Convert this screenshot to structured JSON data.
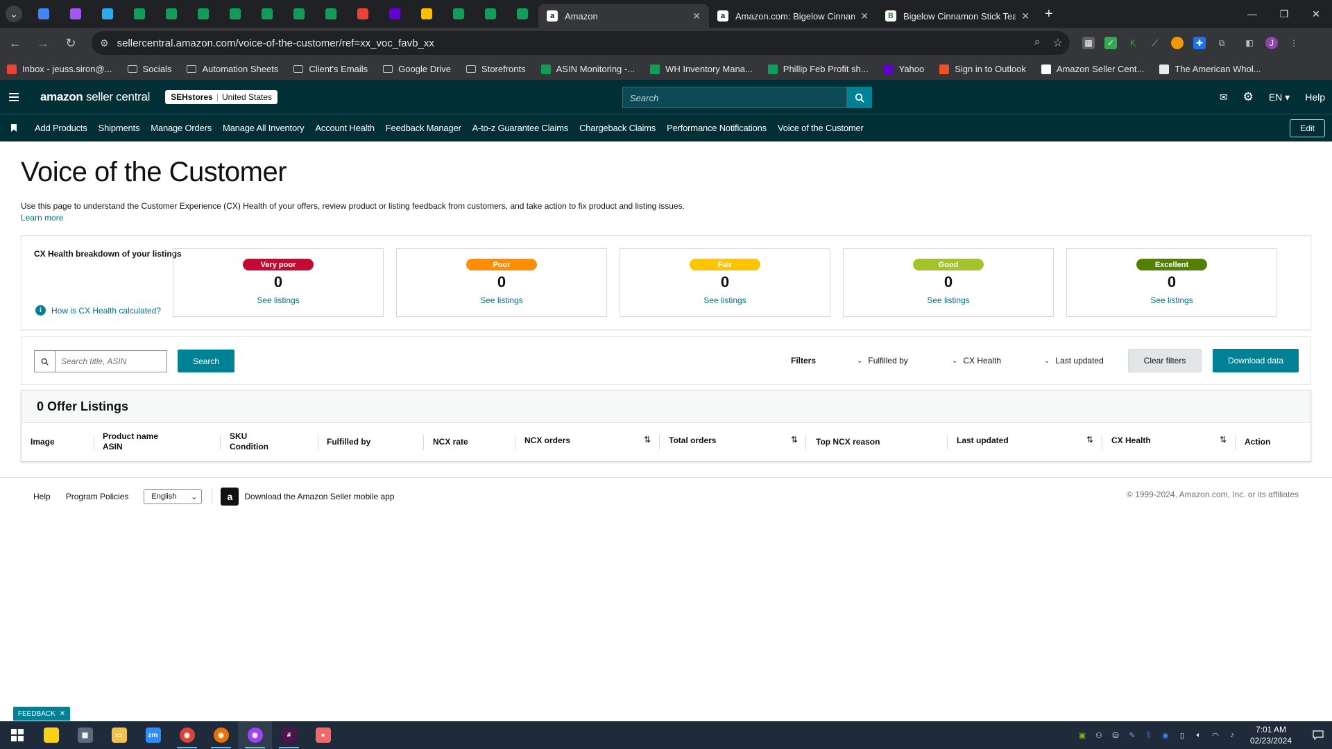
{
  "browser": {
    "pinned_tabs": [
      {
        "icon": "google-docs-icon",
        "color": "#4285f4"
      },
      {
        "icon": "messenger-icon",
        "color": "#a855f7"
      },
      {
        "icon": "telegram-icon",
        "color": "#2aabee"
      },
      {
        "icon": "google-sheets-icon",
        "color": "#0f9d58"
      },
      {
        "icon": "google-sheets-icon",
        "color": "#0f9d58"
      },
      {
        "icon": "google-sheets-icon",
        "color": "#0f9d58"
      },
      {
        "icon": "google-sheets-icon",
        "color": "#0f9d58"
      },
      {
        "icon": "google-sheets-icon",
        "color": "#0f9d58"
      },
      {
        "icon": "google-sheets-icon",
        "color": "#0f9d58"
      },
      {
        "icon": "google-sheets-icon",
        "color": "#0f9d58"
      },
      {
        "icon": "gmail-icon",
        "color": "#ea4335"
      },
      {
        "icon": "yahoo-mail-icon",
        "color": "#6001d2"
      },
      {
        "icon": "google-drive-icon",
        "color": "#fbbc04"
      },
      {
        "icon": "google-sheets-icon",
        "color": "#0f9d58"
      },
      {
        "icon": "google-sheets-icon",
        "color": "#0f9d58"
      },
      {
        "icon": "google-sheets-icon",
        "color": "#0f9d58"
      }
    ],
    "tabs": [
      {
        "title": "Amazon",
        "active": true
      },
      {
        "title": "Amazon.com: Bigelow Cinnamon",
        "active": false
      },
      {
        "title": "Bigelow Cinnamon Stick Tea Ba",
        "active": false
      }
    ],
    "url": "sellercentral.amazon.com/voice-of-the-customer/ref=xx_voc_favb_xx",
    "bookmarks": [
      {
        "label": "Inbox - jeuss.siron@...",
        "icon": "gmail-icon"
      },
      {
        "label": "Socials",
        "icon": "folder-icon"
      },
      {
        "label": "Automation Sheets",
        "icon": "folder-icon"
      },
      {
        "label": "Client's Emails",
        "icon": "folder-icon"
      },
      {
        "label": "Google Drive",
        "icon": "folder-icon"
      },
      {
        "label": "Storefronts",
        "icon": "folder-icon"
      },
      {
        "label": "ASIN Monitoring -...",
        "icon": "google-sheets-icon"
      },
      {
        "label": "WH Inventory Mana...",
        "icon": "google-sheets-icon"
      },
      {
        "label": "Phillip Feb Profit sh...",
        "icon": "google-sheets-icon"
      },
      {
        "label": "Yahoo",
        "icon": "yahoo-icon"
      },
      {
        "label": "Sign in to Outlook",
        "icon": "microsoft-icon"
      },
      {
        "label": "Amazon Seller Cent...",
        "icon": "amazon-icon"
      },
      {
        "label": "The American Whol...",
        "icon": "globe-icon"
      }
    ]
  },
  "header": {
    "logo_main": "amazon",
    "logo_sub": "seller central",
    "store_name": "SEHstores",
    "marketplace": "United States",
    "search_placeholder": "Search",
    "language": "EN",
    "help": "Help"
  },
  "nav": {
    "items": [
      "Add Products",
      "Shipments",
      "Manage Orders",
      "Manage All Inventory",
      "Account Health",
      "Feedback Manager",
      "A-to-z Guarantee Claims",
      "Chargeback Claims",
      "Performance Notifications",
      "Voice of the Customer"
    ],
    "edit_label": "Edit"
  },
  "page": {
    "title": "Voice of the Customer",
    "description": "Use this page to understand the Customer Experience (CX) Health of your offers, review product or listing feedback from customers, and take action to fix product and listing issues.",
    "learn_more": "Learn more"
  },
  "health": {
    "label": "CX Health breakdown of your listings",
    "how_link": "How is CX Health calculated?",
    "cards": [
      {
        "badge": "Very poor",
        "color": "#c40a32",
        "count": "0",
        "link": "See listings"
      },
      {
        "badge": "Poor",
        "color": "#ff8f00",
        "count": "0",
        "link": "See listings"
      },
      {
        "badge": "Fair",
        "color": "#ffc400",
        "count": "0",
        "link": "See listings"
      },
      {
        "badge": "Good",
        "color": "#a2c429",
        "count": "0",
        "link": "See listings"
      },
      {
        "badge": "Excellent",
        "color": "#538000",
        "count": "0",
        "link": "See listings"
      }
    ]
  },
  "filters": {
    "search_placeholder": "Search title, ASIN",
    "search_button": "Search",
    "filters_label": "Filters",
    "fulfilled_by": "Fulfilled by",
    "cx_health": "CX Health",
    "last_updated": "Last updated",
    "clear_button": "Clear filters",
    "download_button": "Download data"
  },
  "listings": {
    "heading": "0 Offer Listings",
    "columns": {
      "image": "Image",
      "product_name": "Product name",
      "asin": "ASIN",
      "sku": "SKU",
      "condition": "Condition",
      "fulfilled_by": "Fulfilled by",
      "ncx_rate": "NCX rate",
      "ncx_orders": "NCX orders",
      "total_orders": "Total orders",
      "top_ncx_reason": "Top NCX reason",
      "last_updated": "Last updated",
      "cx_health": "CX Health",
      "action": "Action"
    }
  },
  "footer": {
    "help": "Help",
    "program_policies": "Program Policies",
    "language": "English",
    "app_link": "Download the Amazon Seller mobile app",
    "copyright": "© 1999-2024, Amazon.com, Inc. or its affiliates"
  },
  "feedback_tab": "FEEDBACK",
  "taskbar": {
    "apps": [
      {
        "icon": "sticky-notes-icon",
        "color": "#f7d117"
      },
      {
        "icon": "calculator-icon",
        "color": "#5b6b7c"
      },
      {
        "icon": "file-explorer-icon",
        "color": "#f3c24a"
      },
      {
        "icon": "zoom-icon",
        "color": "#2d8cff"
      },
      {
        "icon": "chrome-icon",
        "color": "#db4437"
      },
      {
        "icon": "chrome-icon",
        "color": "#e8710a"
      },
      {
        "icon": "chrome-icon",
        "color": "#a142f4"
      },
      {
        "icon": "slack-icon",
        "color": "#4a154b"
      },
      {
        "icon": "asana-icon",
        "color": "#f06a6a"
      }
    ],
    "time": "7:01 AM",
    "date": "02/23/2024"
  }
}
